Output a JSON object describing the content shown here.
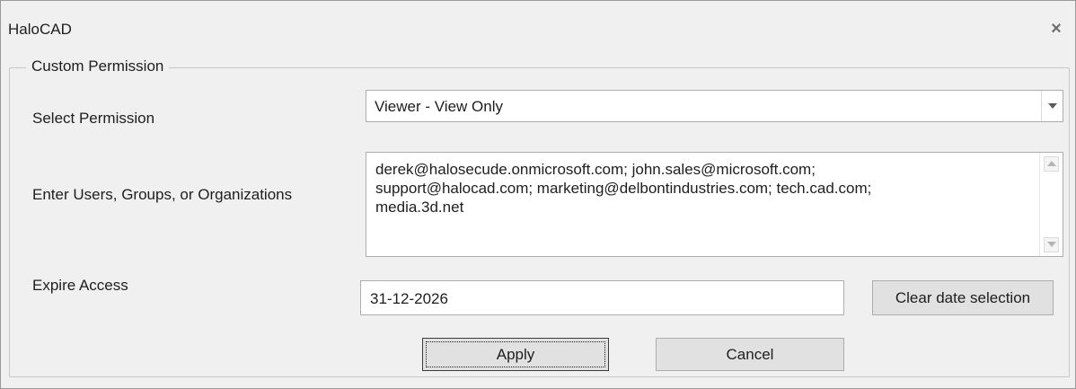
{
  "window": {
    "title": "HaloCAD",
    "close_glyph": "×"
  },
  "group": {
    "legend": "Custom Permission"
  },
  "permission": {
    "label": "Select Permission",
    "selected": "Viewer - View Only"
  },
  "users": {
    "label": "Enter Users, Groups, or Organizations",
    "value": "derek@halosecude.onmicrosoft.com; john.sales@microsoft.com;\nsupport@halocad.com; marketing@delbontindustries.com; tech.cad.com;\nmedia.3d.net"
  },
  "expire": {
    "label": "Expire Access",
    "date_value": "31-12-2026",
    "clear_label": "Clear date selection"
  },
  "actions": {
    "apply_label": "Apply",
    "cancel_label": "Cancel"
  },
  "icons": {
    "close": "close-icon",
    "dropdown": "chevron-down-icon",
    "scroll_up": "scroll-up-arrow-icon",
    "scroll_down": "scroll-down-arrow-icon"
  }
}
